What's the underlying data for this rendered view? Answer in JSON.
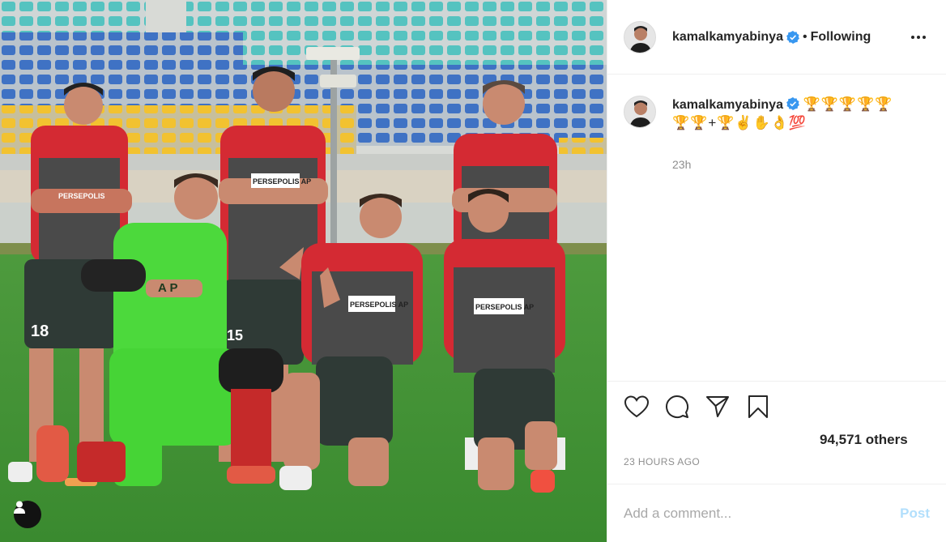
{
  "post": {
    "photo_alt": "",
    "jersey_numbers": [
      "18",
      "15"
    ],
    "shirt_text": "PERSEPOLIS APP"
  },
  "header": {
    "username": "kamalkamyabinya",
    "separator": "•",
    "follow_state": "Following",
    "more_icon": "ellipsis-icon"
  },
  "caption": {
    "username": "kamalkamyabinya",
    "text": "🏆🏆🏆🏆🏆 🏆🏆+🏆✌️✋👌💯",
    "time": "23h"
  },
  "actions": {
    "like_icon": "heart-icon",
    "comment_icon": "comment-icon",
    "share_icon": "share-icon",
    "save_icon": "bookmark-icon"
  },
  "likes": {
    "text": "94,571 others"
  },
  "timestamp": "23 HOURS AGO",
  "comment_box": {
    "placeholder": "Add a comment...",
    "post_label": "Post"
  },
  "colors": {
    "verified_blue": "#3897f0",
    "post_button": "#b2dffc",
    "jersey_red": "#d42a33",
    "goalkeeper_green": "#4cd93c",
    "pitch_green": "#3f8f34"
  }
}
